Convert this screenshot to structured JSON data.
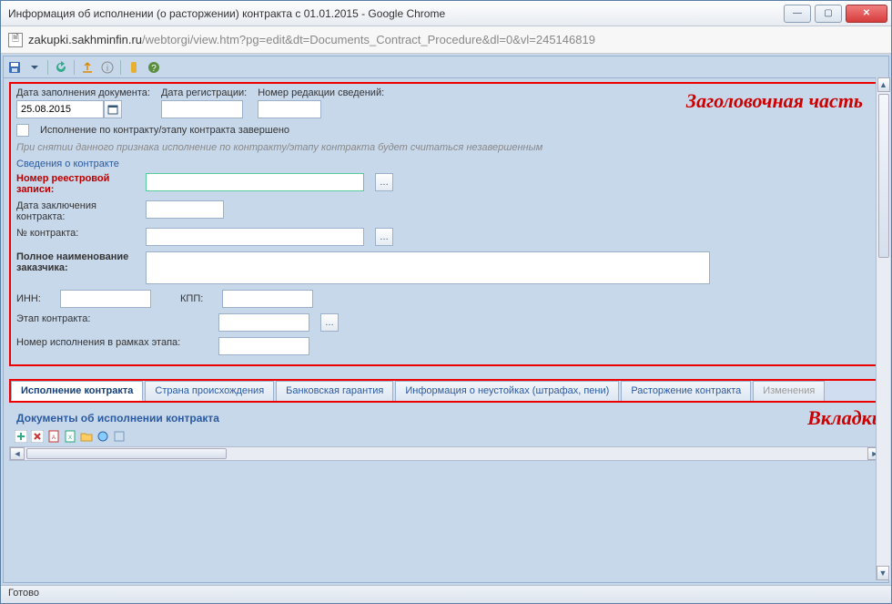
{
  "window": {
    "title": "Информация об исполнении (о расторжении) контракта с 01.01.2015 - Google Chrome",
    "url_dark": "zakupki.sakhminfin.ru",
    "url_rest": "/webtorgi/view.htm?pg=edit&dt=Documents_Contract_Procedure&dl=0&vl=245146819"
  },
  "callouts": {
    "header": "Заголовочная часть",
    "tabs": "Вкладки"
  },
  "top": {
    "fill_date_label": "Дата заполнения документа:",
    "fill_date_value": "25.08.2015",
    "reg_date_label": "Дата регистрации:",
    "rev_num_label": "Номер редакции сведений:"
  },
  "completion": {
    "checkbox_label": "Исполнение по контракту/этапу контракта завершено",
    "hint": "При снятии данного признака исполнение по контракту/этапу контракта будет считаться незавершенным"
  },
  "contract": {
    "section_title": "Сведения о контракте",
    "reg_number_label": "Номер реестровой записи:",
    "contract_date_label": "Дата заключения контракта:",
    "contract_num_label": "№ контракта:",
    "customer_name_label": "Полное наименование заказчика:",
    "inn_label": "ИНН:",
    "kpp_label": "КПП:",
    "stage_label": "Этап контракта:",
    "exec_num_label": "Номер исполнения в рамках этапа:"
  },
  "tabs": [
    "Исполнение контракта",
    "Страна происхождения",
    "Банковская гарантия",
    "Информация о неустойках (штрафах, пени)",
    "Расторжение контракта",
    "Изменения"
  ],
  "subsection": {
    "title": "Документы об исполнении контракта"
  },
  "status": "Готово"
}
